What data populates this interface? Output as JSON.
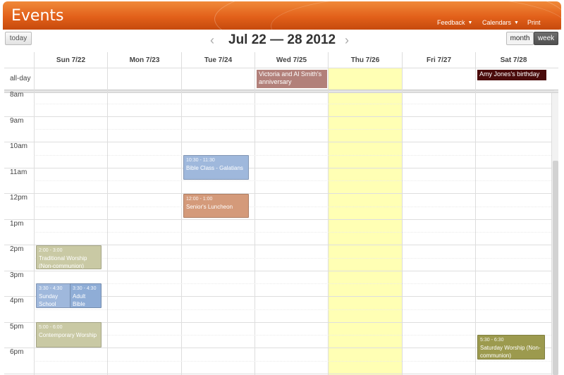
{
  "header": {
    "title": "Events",
    "menu": {
      "feedback": "Feedback",
      "calendars": "Calendars",
      "print": "Print"
    }
  },
  "toolbar": {
    "today_label": "today",
    "range_title": "Jul 22 — 28 2012",
    "prev_icon": "chevron-left-icon",
    "next_icon": "chevron-right-icon",
    "view_month": "month",
    "view_week": "week",
    "active_view": "week"
  },
  "calendar": {
    "days": [
      "Sun 7/22",
      "Mon 7/23",
      "Tue 7/24",
      "Wed 7/25",
      "Thu 7/26",
      "Fri 7/27",
      "Sat 7/28"
    ],
    "today_column": "Thu 7/26",
    "allday_label": "all-day",
    "hours": [
      "8am",
      "9am",
      "10am",
      "11am",
      "12pm",
      "1pm",
      "2pm",
      "3pm",
      "4pm",
      "5pm",
      "6pm"
    ],
    "allday_events": [
      {
        "day": "Wed 7/25",
        "title": "Victoria and Al Smith's anniversary",
        "color": "#b2807a"
      },
      {
        "day": "Sat 7/28",
        "title": "Amy Jones's birthday",
        "color": "#4a0b0b"
      }
    ],
    "events": [
      {
        "day": "Tue 7/24",
        "time": "10:30 - 11:30",
        "title": "Bible Class - Galatians",
        "color": "#9fb8dc"
      },
      {
        "day": "Tue 7/24",
        "time": "12:00 - 1:00",
        "title": "Senior's Luncheon",
        "color": "#d49a7a"
      },
      {
        "day": "Sun 7/22",
        "time": "2:00 - 3:00",
        "title": "Traditional Worship (Non-communion)",
        "color": "#c9c9a4"
      },
      {
        "day": "Sun 7/22",
        "time": "3:30 - 4:30",
        "title": "Sunday School",
        "color": "#9fb8dc"
      },
      {
        "day": "Sun 7/22",
        "time": "3:30 - 4:30",
        "title": "Adult Bible",
        "color": "#8fadd6"
      },
      {
        "day": "Sun 7/22",
        "time": "5:00 - 6:00",
        "title": "Contemporary Worship",
        "color": "#c9c9a4"
      },
      {
        "day": "Sat 7/28",
        "time": "5:30 - 6:30",
        "title": "Saturday Worship (Non-communion)",
        "color": "#9c9a4e"
      }
    ]
  }
}
